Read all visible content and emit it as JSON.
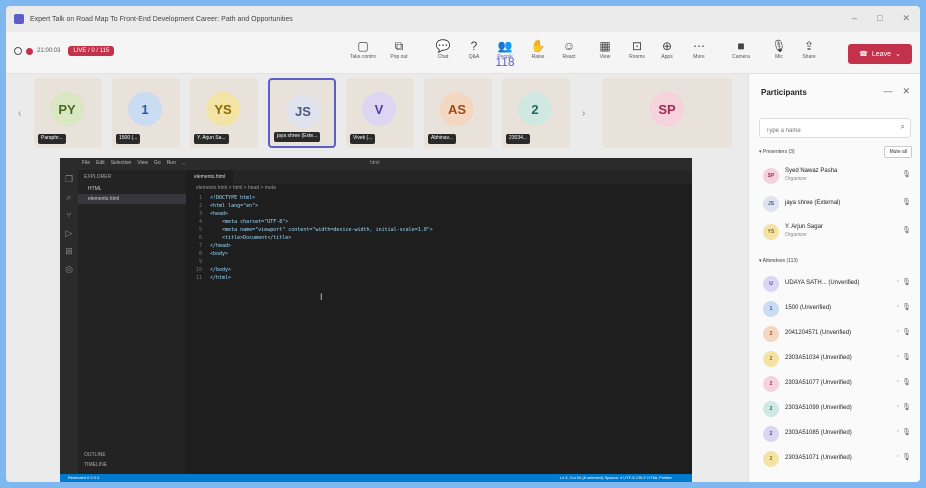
{
  "window": {
    "title": "Expert Talk on Road Map To Front-End Development Career: Path and Opportunities"
  },
  "toolbar": {
    "timer": "21:00:03",
    "live_badge": "LIVE / 0 / 115",
    "buttons": [
      {
        "label": "Take control",
        "icon": "control-icon"
      },
      {
        "label": "Pop out",
        "icon": "popout-icon"
      },
      {
        "label": "Chat",
        "icon": "chat-icon"
      },
      {
        "label": "Q&A",
        "icon": "qa-icon"
      },
      {
        "label": "People",
        "icon": "people-icon",
        "count": "118"
      },
      {
        "label": "Raise",
        "icon": "raise-hand-icon"
      },
      {
        "label": "React",
        "icon": "react-icon"
      },
      {
        "label": "View",
        "icon": "view-icon"
      },
      {
        "label": "Rooms",
        "icon": "rooms-icon"
      },
      {
        "label": "Apps",
        "icon": "apps-icon"
      },
      {
        "label": "More",
        "icon": "more-icon"
      },
      {
        "label": "Camera",
        "icon": "camera-icon"
      },
      {
        "label": "Mic",
        "icon": "mic-icon"
      },
      {
        "label": "Share",
        "icon": "share-icon"
      }
    ],
    "leave": "Leave"
  },
  "tiles": [
    {
      "initials": "PY",
      "name": "Paraphr...",
      "bg": "#d9e8c2",
      "fg": "#4a6b1f"
    },
    {
      "initials": "1",
      "name": "1500 (...",
      "bg": "#c9dcf2",
      "fg": "#2b5aa1"
    },
    {
      "initials": "YS",
      "name": "Y. Arjun Sa...",
      "bg": "#f3e4a6",
      "fg": "#8a6b00"
    },
    {
      "initials": "JS",
      "name": "jaya shree (Exte...",
      "bg": "#dfe3ee",
      "fg": "#4a5a82"
    },
    {
      "initials": "V",
      "name": "Vivek (...",
      "bg": "#dcd6f2",
      "fg": "#4c3fa3"
    },
    {
      "initials": "AS",
      "name": "Abhinav...",
      "bg": "#f4d7c1",
      "fg": "#9a4c16"
    },
    {
      "initials": "2",
      "name": "23034...",
      "bg": "#cfe8e2",
      "fg": "#1e6b5a"
    },
    {
      "initials": "SP",
      "name": "",
      "bg": "#f6d2dc",
      "fg": "#a12b52"
    }
  ],
  "editor": {
    "menu": [
      "File",
      "Edit",
      "Selection",
      "View",
      "Go",
      "Run",
      "..."
    ],
    "search": "html",
    "explorer": "EXPLORER",
    "folder": "HTML",
    "file": "elements.html",
    "tab": "elements.html",
    "breadcrumb": "elements.html > html > head > meta",
    "outline": "OUTLINE",
    "timeline": "TIMELINE",
    "status_left": "Restricted  0 0 0  0",
    "status_right": "Ln 5, Col 54 (8 selected)  Spaces: 4  UTF-8  CRLF  HTML  Prettier",
    "lines": [
      {
        "n": "1",
        "t": "<!DOCTYPE html>"
      },
      {
        "n": "2",
        "t": "<html lang=\"en\">"
      },
      {
        "n": "3",
        "t": "<head>"
      },
      {
        "n": "4",
        "t": "    <meta charset=\"UTF-8\">"
      },
      {
        "n": "5",
        "t": "    <meta name=\"viewport\" content=\"width=device-width, initial-scale=1.0\">"
      },
      {
        "n": "6",
        "t": "    <title>Document</title>"
      },
      {
        "n": "7",
        "t": "</head>"
      },
      {
        "n": "8",
        "t": "<body>"
      },
      {
        "n": "9",
        "t": ""
      },
      {
        "n": "10",
        "t": "</body>"
      },
      {
        "n": "11",
        "t": "</html>"
      }
    ]
  },
  "panel": {
    "title": "Participants",
    "search_placeholder": "Type a name",
    "presenters_label": "Presenters (3)",
    "mute_all": "Mute all",
    "attendees_label": "Attendees (113)",
    "presenters": [
      {
        "initials": "SP",
        "name": "Syed Nawaz Pasha",
        "role": "Organizer",
        "bg": "#f6d2dc",
        "fg": "#a12b52"
      },
      {
        "initials": "JS",
        "name": "jaya shree (External)",
        "role": "",
        "bg": "#dfe3ee",
        "fg": "#4a5a82"
      },
      {
        "initials": "YS",
        "name": "Y. Arjun Sagar",
        "role": "Organizer",
        "bg": "#f3e4a6",
        "fg": "#8a6b00"
      }
    ],
    "attendees": [
      {
        "initials": "U",
        "name": "UDAYA SATH...  (Unverified)",
        "bg": "#dcd6f2",
        "fg": "#4c3fa3"
      },
      {
        "initials": "1",
        "name": "1500 (Unverified)",
        "bg": "#c9dcf2",
        "fg": "#2b5aa1"
      },
      {
        "initials": "2",
        "name": "2041204571 (Unverified)",
        "bg": "#f4d7c1",
        "fg": "#9a4c16"
      },
      {
        "initials": "2",
        "name": "2303A51034 (Unverified)",
        "bg": "#f3e4a6",
        "fg": "#8a6b00"
      },
      {
        "initials": "2",
        "name": "2303A51077 (Unverified)",
        "bg": "#f6d2dc",
        "fg": "#a12b52"
      },
      {
        "initials": "2",
        "name": "2303A51099 (Unverified)",
        "bg": "#cfe8e2",
        "fg": "#1e6b5a"
      },
      {
        "initials": "2",
        "name": "2303A51085 (Unverified)",
        "bg": "#dcd6f2",
        "fg": "#4c3fa3"
      },
      {
        "initials": "2",
        "name": "2303A51071 (Unverified)",
        "bg": "#f3e4a6",
        "fg": "#8a6b00"
      }
    ]
  }
}
